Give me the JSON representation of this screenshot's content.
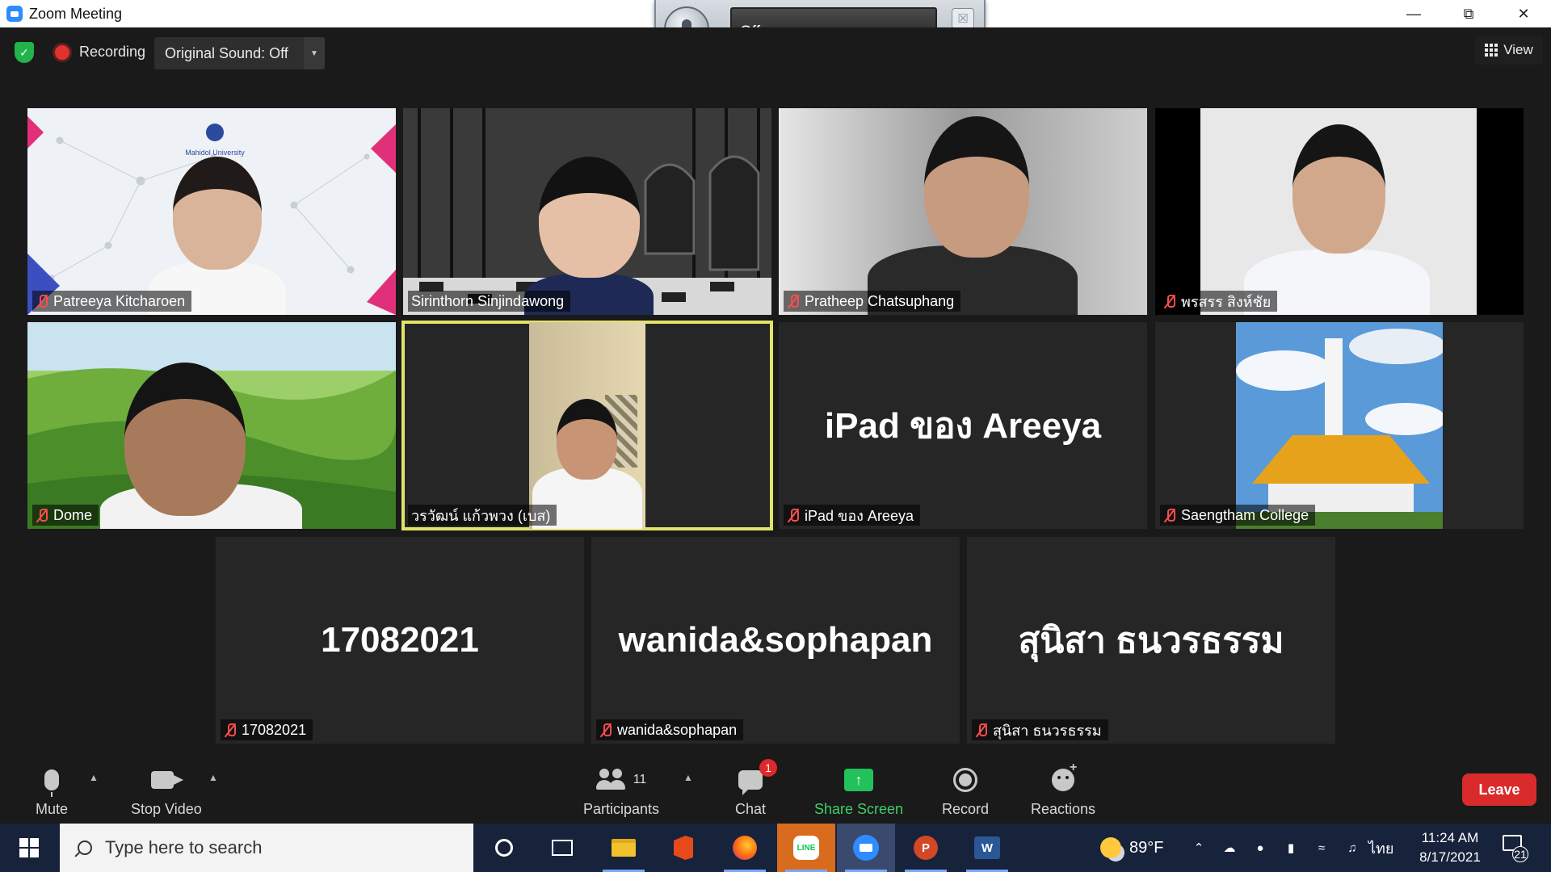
{
  "window": {
    "title": "Zoom Meeting"
  },
  "audio_widget": {
    "status": "Off"
  },
  "status_bar": {
    "recording_label": "Recording",
    "original_sound_label": "Original Sound: Off",
    "view_label": "View"
  },
  "participants": [
    {
      "name": "Patreeya Kitcharoen",
      "muted": true,
      "video": true
    },
    {
      "name": "Sirinthorn Sinjindawong",
      "muted": false,
      "video": true
    },
    {
      "name": "Pratheep Chatsuphang",
      "muted": true,
      "video": true
    },
    {
      "name": "พรสรร สิงห์ชัย",
      "muted": true,
      "video": true
    },
    {
      "name": "Dome",
      "muted": true,
      "video": true
    },
    {
      "name": "วรวัฒน์ แก้วพวง (เบส)",
      "muted": false,
      "video": true,
      "active_speaker": true
    },
    {
      "name": "iPad ของ Areeya",
      "muted": true,
      "video": false,
      "display_name": "iPad ของ Areeya"
    },
    {
      "name": "Saengtham College",
      "muted": true,
      "video": true
    },
    {
      "name": "17082021",
      "muted": true,
      "video": false,
      "display_name": "17082021"
    },
    {
      "name": "wanida&sophapan",
      "muted": true,
      "video": false,
      "display_name": "wanida&sophapan"
    },
    {
      "name": "สุนิสา ธนวรธรรม",
      "muted": true,
      "video": false,
      "display_name": "สุนิสา ธนวรธรรม"
    }
  ],
  "tile_logo_text": "Mahidol University",
  "toolbar": {
    "mute": "Mute",
    "stop_video": "Stop Video",
    "participants": "Participants",
    "participants_count": "11",
    "chat": "Chat",
    "chat_badge": "1",
    "share_screen": "Share Screen",
    "record": "Record",
    "reactions": "Reactions",
    "leave": "Leave"
  },
  "taskbar": {
    "search_placeholder": "Type here to search",
    "weather": "89°F",
    "language": "ไทย",
    "time": "11:24 AM",
    "date": "8/17/2021",
    "notification_count": "21"
  },
  "colors": {
    "active_speaker_border": "#e3e36a",
    "leave": "#d92b2b",
    "share": "#23c159",
    "muted_icon": "#ff4d4d"
  }
}
